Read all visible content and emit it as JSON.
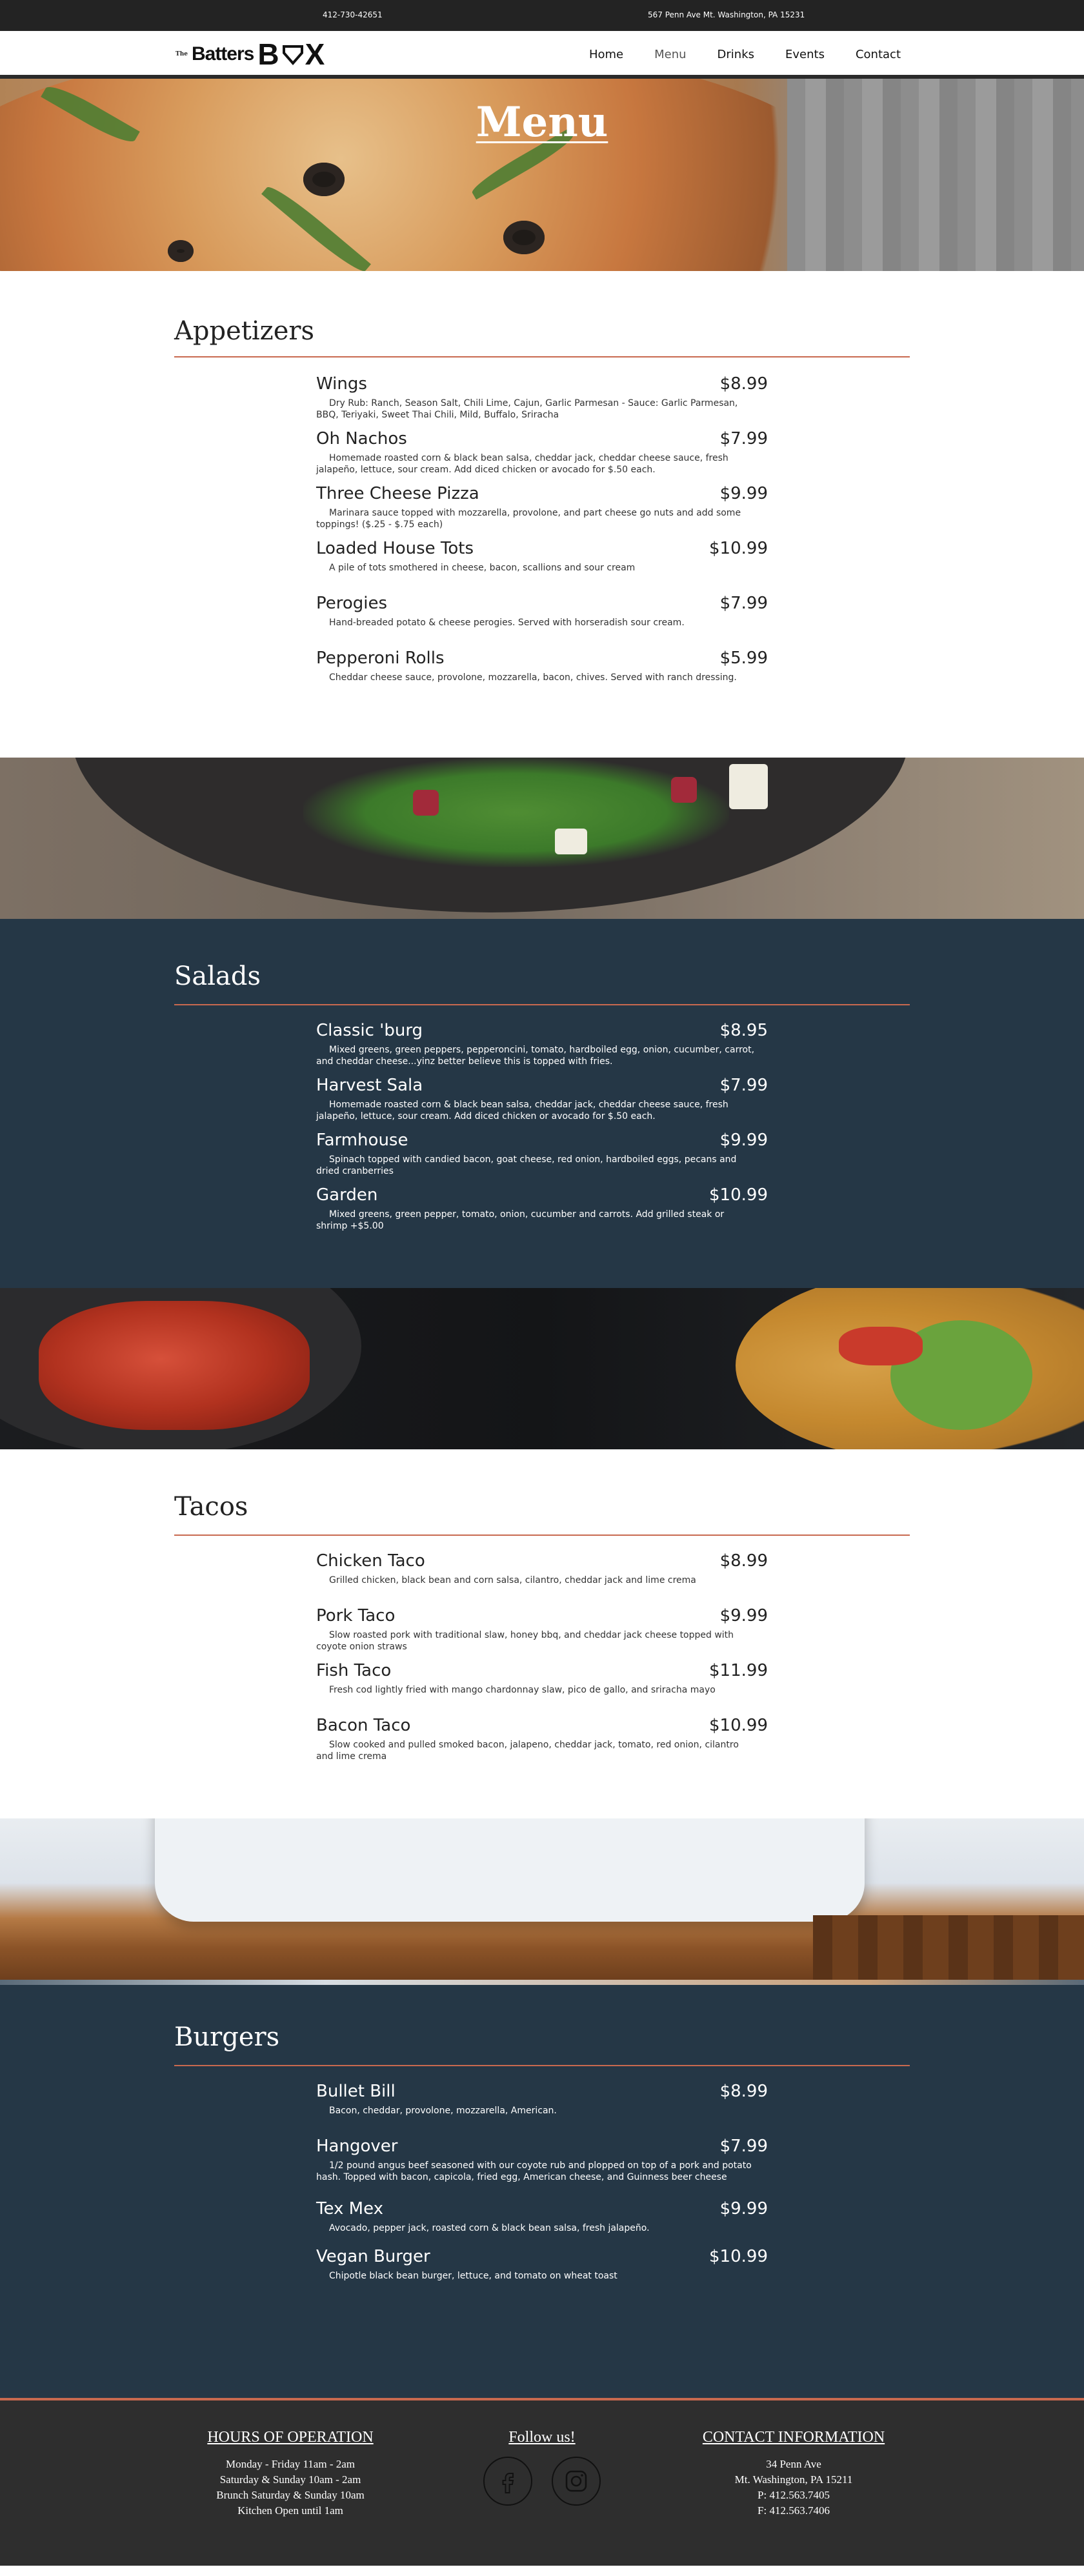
{
  "topbar": {
    "phone": "412-730-42651",
    "address": "567 Penn Ave Mt. Washington, PA 15231"
  },
  "brand": {
    "the": "The",
    "batters": "Batters",
    "box": "B",
    "box_end": "X"
  },
  "nav": {
    "items": [
      {
        "label": "Home"
      },
      {
        "label": "Menu"
      },
      {
        "label": "Drinks"
      },
      {
        "label": "Events"
      },
      {
        "label": "Contact"
      }
    ]
  },
  "hero": {
    "title": "Menu"
  },
  "appetizers": {
    "title": "Appetizers",
    "items": [
      {
        "name": "Wings",
        "price": "$8.99",
        "desc": "Dry Rub: Ranch, Season Salt, Chili Lime, Cajun, Garlic Parmesan - Sauce: Garlic Parmesan, BBQ, Teriyaki, Sweet Thai Chili, Mild, Buffalo, Sriracha"
      },
      {
        "name": "Oh Nachos",
        "price": "$7.99",
        "desc": "Homemade roasted corn & black bean salsa, cheddar jack, cheddar cheese sauce, fresh jalapeño, lettuce, sour cream. Add diced chicken or avocado for $.50 each."
      },
      {
        "name": "Three Cheese Pizza",
        "price": "$9.99",
        "desc": "Marinara sauce topped with mozzarella, provolone, and part cheese go nuts and add some toppings! ($.25 - $.75 each)"
      },
      {
        "name": "Loaded House Tots",
        "price": "$10.99",
        "desc": "A pile of tots smothered in cheese, bacon, scallions and sour cream"
      },
      {
        "name": "Perogies",
        "price": "$7.99",
        "desc": "Hand-breaded potato & cheese perogies. Served with horseradish sour cream."
      },
      {
        "name": "Pepperoni Rolls",
        "price": "$5.99",
        "desc": "Cheddar cheese sauce, provolone, mozzarella, bacon, chives. Served with ranch dressing."
      }
    ]
  },
  "salads": {
    "title": "Salads",
    "items": [
      {
        "name": "Classic 'burg",
        "price": "$8.95",
        "desc": "Mixed greens, green peppers, pepperoncini, tomato, hardboiled egg, onion, cucumber, carrot, and cheddar cheese...yinz better believe this is topped with fries."
      },
      {
        "name": "Harvest Sala",
        "price": "$7.99",
        "desc": "Homemade roasted corn & black bean salsa, cheddar jack, cheddar cheese sauce, fresh jalapeño, lettuce, sour cream. Add diced chicken or avocado for $.50 each."
      },
      {
        "name": "Farmhouse",
        "price": "$9.99",
        "desc": "Spinach topped with candied bacon, goat cheese, red onion, hardboiled eggs, pecans and dried cranberries"
      },
      {
        "name": "Garden",
        "price": "$10.99",
        "desc": "Mixed greens, green pepper, tomato, onion, cucumber and carrots. Add grilled steak or shrimp +$5.00"
      }
    ]
  },
  "tacos": {
    "title": "Tacos",
    "items": [
      {
        "name": "Chicken Taco",
        "price": "$8.99",
        "desc": "Grilled chicken, black bean and corn salsa, cilantro, cheddar jack and lime crema"
      },
      {
        "name": "Pork Taco",
        "price": "$9.99",
        "desc": "Slow roasted pork with traditional slaw, honey bbq, and cheddar jack cheese topped with coyote onion straws"
      },
      {
        "name": "Fish Taco",
        "price": "$11.99",
        "desc": "Fresh cod lightly fried with mango chardonnay slaw, pico de gallo, and sriracha mayo"
      },
      {
        "name": "Bacon Taco",
        "price": "$10.99",
        "desc": "Slow cooked and pulled smoked bacon, jalapeno, cheddar jack, tomato, red onion, cilantro and lime crema"
      }
    ]
  },
  "burgers": {
    "title": "Burgers",
    "items": [
      {
        "name": "Bullet Bill",
        "price": "$8.99",
        "desc": "Bacon, cheddar, provolone, mozzarella, American."
      },
      {
        "name": "Hangover",
        "price": "$7.99",
        "desc": "1/2 pound angus beef seasoned with our coyote rub and plopped on top of a pork and potato hash. Topped with bacon, capicola, fried egg, American cheese, and Guinness beer cheese"
      },
      {
        "name": "Tex Mex",
        "price": "$9.99",
        "desc": "Avocado, pepper jack, roasted corn & black bean salsa, fresh jalapeño."
      },
      {
        "name": "Vegan Burger",
        "price": "$10.99",
        "desc": "Chipotle black bean burger, lettuce, and tomato on wheat toast"
      }
    ]
  },
  "footer": {
    "hours": {
      "title": "HOURS OF OPERATION",
      "lines": [
        "Monday - Friday 11am - 2am",
        "Saturday & Sunday 10am - 2am",
        "Brunch Saturday & Sunday 10am",
        "Kitchen Open until 1am"
      ]
    },
    "follow": {
      "title": "Follow us!"
    },
    "contact": {
      "title": "CONTACT INFORMATION",
      "lines": [
        "34 Penn Ave",
        "Mt. Washington, PA 15211",
        "P: 412.563.7405",
        "F: 412.563.7406"
      ]
    }
  },
  "colors": {
    "accent": "#c8694f",
    "dark_section": "#253746",
    "footer": "#2e2e2e",
    "topbar": "#232323"
  }
}
